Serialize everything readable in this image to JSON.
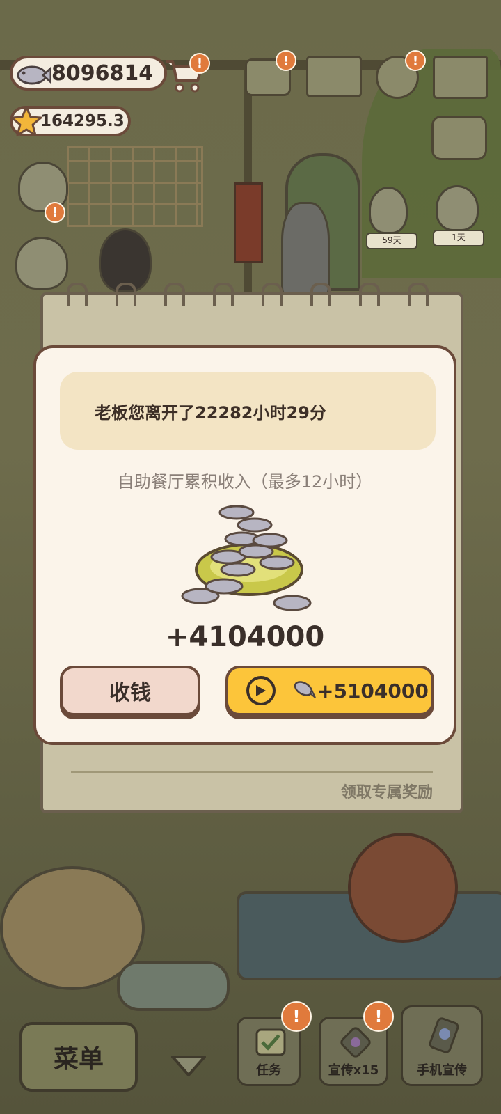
{
  "hud": {
    "fish_count": "8096814",
    "star_count": "164295.3",
    "shop_badge": "!",
    "mail_badge": "!",
    "gear_badge": "!"
  },
  "scene": {
    "left_cat_badge": "!",
    "cat1_days": "59天",
    "cat2_days": "1天"
  },
  "notebook": {
    "footer_link": "领取专属奖励"
  },
  "dialog": {
    "away_message": "老板您离开了22282小时29分",
    "income_subtitle": "自助餐厅累积收入（最多12小时）",
    "income_amount": "+4104000",
    "collect_label": "收钱",
    "video_reward_label": "+5104000"
  },
  "bottom_bar": {
    "menu_label": "菜单",
    "tasks_label": "任务",
    "tasks_badge": "!",
    "promo_label": "宣传x15",
    "promo_badge": "!",
    "phone_promo_label": "手机宣传"
  },
  "colors": {
    "accent_yellow": "#fcc53a",
    "badge_orange": "#e07a3c",
    "border_brown": "#6b4a3a",
    "dialog_bg": "#fbf4ea"
  }
}
